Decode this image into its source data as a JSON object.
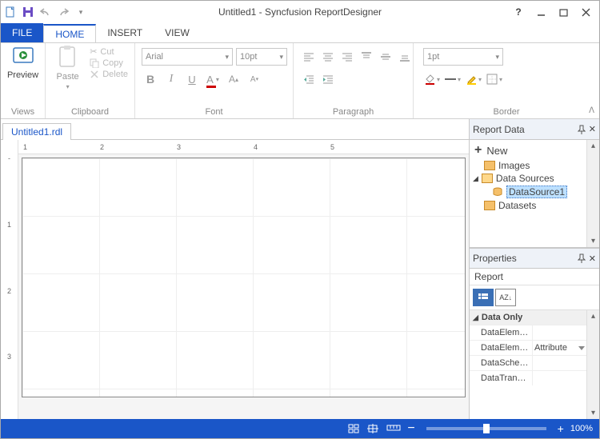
{
  "window": {
    "title": "Untitled1 - Syncfusion ReportDesigner"
  },
  "tabs": {
    "file": "FILE",
    "home": "HOME",
    "insert": "INSERT",
    "view": "VIEW"
  },
  "ribbon": {
    "views": {
      "label": "Views",
      "preview": "Preview"
    },
    "clipboard": {
      "label": "Clipboard",
      "paste": "Paste",
      "cut": "Cut",
      "copy": "Copy",
      "delete": "Delete"
    },
    "font": {
      "label": "Font",
      "family": "Arial",
      "size": "10pt"
    },
    "paragraph": {
      "label": "Paragraph"
    },
    "border": {
      "label": "Border",
      "width": "1pt"
    }
  },
  "document": {
    "tab": "Untitled1.rdl"
  },
  "reportData": {
    "title": "Report Data",
    "new": "New",
    "nodes": {
      "images": "Images",
      "dataSources": "Data Sources",
      "ds1": "DataSource1",
      "datasets": "Datasets"
    }
  },
  "properties": {
    "title": "Properties",
    "object": "Report",
    "cat": "Data Only",
    "rows": [
      {
        "name": "DataEleme...",
        "val": ""
      },
      {
        "name": "DataEleme...",
        "val": "Attribute"
      },
      {
        "name": "DataSchema",
        "val": ""
      },
      {
        "name": "DataTransf...",
        "val": ""
      }
    ]
  },
  "status": {
    "zoom": "100%"
  },
  "ruler": {
    "h": [
      "1",
      "2",
      "3",
      "4",
      "5"
    ],
    "v": [
      "1",
      "2",
      "3"
    ]
  }
}
